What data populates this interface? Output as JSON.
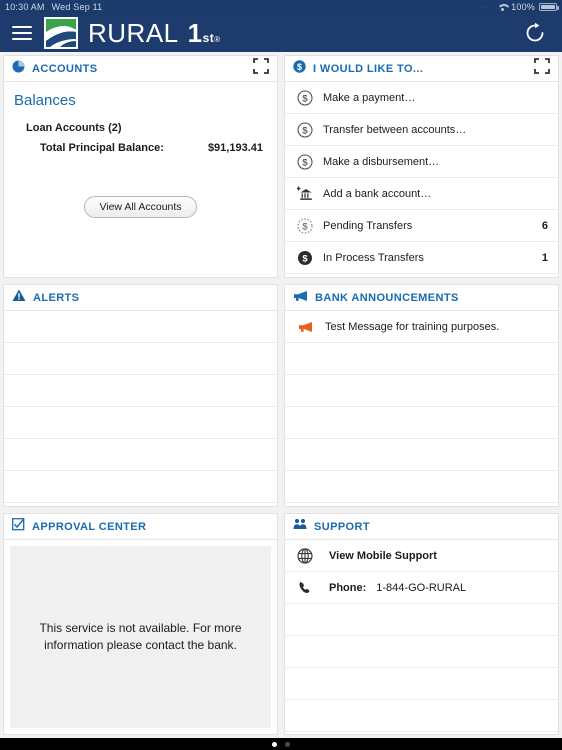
{
  "status_bar": {
    "time": "10:30 AM",
    "date": "Wed Sep 11",
    "battery_percent": "100%",
    "wifi_icon": "wifi-icon",
    "battery_icon": "battery-icon"
  },
  "app_bar": {
    "menu_icon": "hamburger-menu-icon",
    "logo_icon": "rural-1st-logo-icon",
    "brand_name": "RURAL",
    "brand_suffix": "1",
    "brand_superscript": "st",
    "brand_registered": "®",
    "refresh_icon": "refresh-icon",
    "background_color": "#1d3c6d"
  },
  "panels": {
    "accounts": {
      "title": "ACCOUNTS",
      "icon": "pie-chart-icon",
      "expand_icon": "expand-icon",
      "balances_heading": "Balances",
      "group_label": "Loan Accounts (2)",
      "balance_label": "Total Principal Balance:",
      "balance_value": "$91,193.41",
      "view_all_label": "View All Accounts"
    },
    "i_would_like_to": {
      "title": "I WOULD LIKE TO...",
      "icon": "dollar-circle-icon",
      "expand_icon": "expand-icon",
      "items": [
        {
          "label": "Make a payment…",
          "icon": "dollar-circle-outline-icon",
          "count": ""
        },
        {
          "label": "Transfer between accounts…",
          "icon": "dollar-circle-outline-icon",
          "count": ""
        },
        {
          "label": "Make a disbursement…",
          "icon": "dollar-circle-outline-icon",
          "count": ""
        },
        {
          "label": "Add a bank account…",
          "icon": "bank-add-icon",
          "count": ""
        },
        {
          "label": "Pending Transfers",
          "icon": "dollar-circle-dotted-icon",
          "count": "6"
        },
        {
          "label": "In Process Transfers",
          "icon": "dollar-circle-filled-icon",
          "count": "1"
        }
      ]
    },
    "alerts": {
      "title": "ALERTS",
      "icon": "warning-triangle-icon",
      "empty_row_count": 6
    },
    "bank_announcements": {
      "title": "BANK ANNOUNCEMENTS",
      "icon": "megaphone-icon",
      "message": "Test Message for training purposes.",
      "message_icon": "megaphone-orange-icon",
      "empty_row_count": 5
    },
    "approval_center": {
      "title": "APPROVAL CENTER",
      "icon": "checkbox-checked-icon",
      "message": "This service is not available. For more information please contact the bank."
    },
    "support": {
      "title": "SUPPORT",
      "icon": "people-icon",
      "items": [
        {
          "label": "View Mobile Support",
          "icon": "globe-icon",
          "value": ""
        },
        {
          "label": "Phone:",
          "icon": "phone-icon",
          "value": "1-844-GO-RURAL"
        }
      ],
      "empty_row_count": 4
    }
  },
  "footer": {
    "page_dots": 2,
    "active_dot": 1
  },
  "colors": {
    "header_blue": "#1d3c6d",
    "title_blue": "#1a6bb0",
    "accent_orange": "#e8601c",
    "panel_bg": "#ffffff"
  }
}
